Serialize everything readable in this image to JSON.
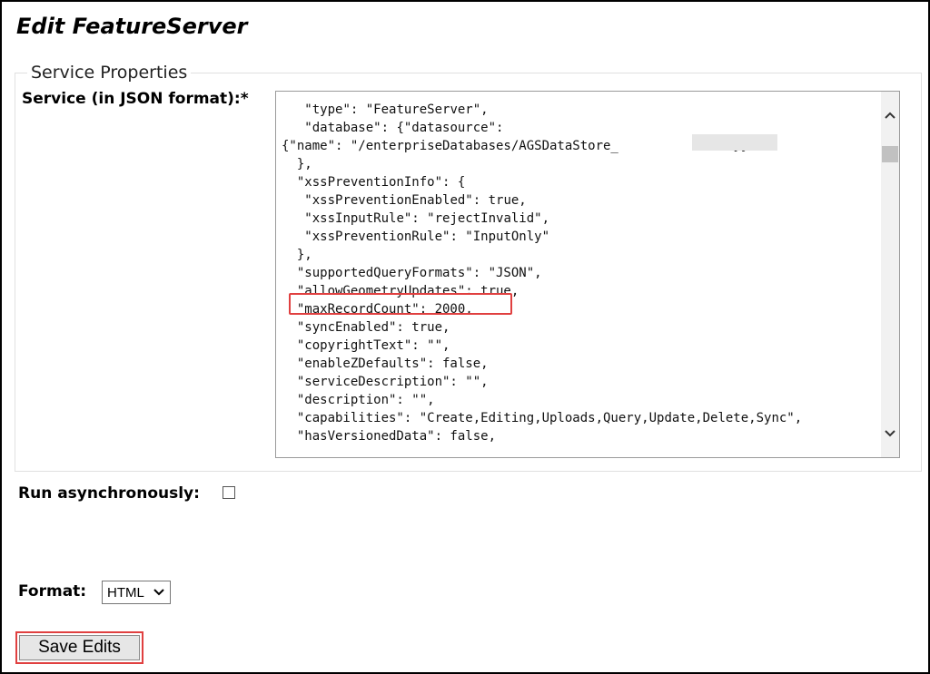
{
  "page": {
    "title": "Edit FeatureServer"
  },
  "service_properties": {
    "legend": "Service Properties",
    "json_label": "Service (in JSON format):*",
    "json_text": "\n   \"type\": \"FeatureServer\",\n   \"database\": {\"datasource\":\n{\"name\": \"/enterpriseDatabases/AGSDataStore_              \"}}\n  },\n  \"xssPreventionInfo\": {\n   \"xssPreventionEnabled\": true,\n   \"xssInputRule\": \"rejectInvalid\",\n   \"xssPreventionRule\": \"InputOnly\"\n  },\n  \"supportedQueryFormats\": \"JSON\",\n  \"allowGeometryUpdates\": true,\n  \"maxRecordCount\": 2000,\n  \"syncEnabled\": true,\n  \"copyrightText\": \"\",\n  \"enableZDefaults\": false,\n  \"serviceDescription\": \"\",\n  \"description\": \"\",\n  \"capabilities\": \"Create,Editing,Uploads,Query,Update,Delete,Sync\",\n  \"hasVersionedData\": false,"
  },
  "run_async": {
    "label": "Run asynchronously:",
    "checked": false
  },
  "format": {
    "label": "Format:",
    "selected": "HTML"
  },
  "save_button": {
    "label": "Save Edits"
  },
  "icons": {
    "scroll_up": "chevron-up-icon",
    "scroll_down": "chevron-down-icon",
    "select_arrow": "chevron-down-icon"
  },
  "colors": {
    "highlight": "#e04040"
  }
}
